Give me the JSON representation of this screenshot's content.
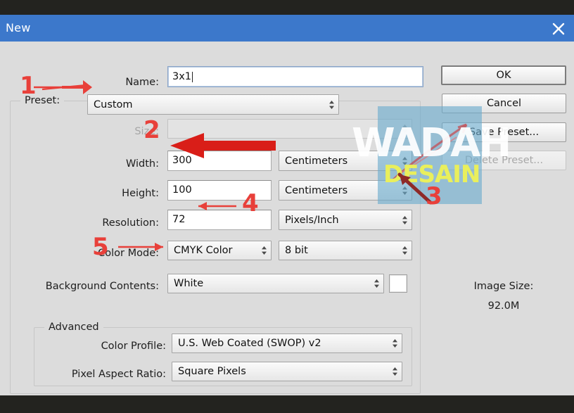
{
  "window": {
    "title": "New",
    "close_icon": "close-icon"
  },
  "form": {
    "name": {
      "label": "Name:",
      "value": "3x1"
    },
    "preset": {
      "label": "Preset:",
      "value": "Custom"
    },
    "size": {
      "label": "Size:",
      "value": ""
    },
    "width": {
      "label": "Width:",
      "value": "300",
      "unit": "Centimeters"
    },
    "height": {
      "label": "Height:",
      "value": "100",
      "unit": "Centimeters"
    },
    "resolution": {
      "label": "Resolution:",
      "value": "72",
      "unit": "Pixels/Inch"
    },
    "color_mode": {
      "label": "Color Mode:",
      "value": "CMYK Color",
      "depth": "8 bit"
    },
    "background": {
      "label": "Background Contents:",
      "value": "White",
      "swatch_color": "#ffffff"
    }
  },
  "advanced": {
    "legend": "Advanced",
    "color_profile": {
      "label": "Color Profile:",
      "value": "U.S. Web Coated (SWOP) v2"
    },
    "pixel_aspect_ratio": {
      "label": "Pixel Aspect Ratio:",
      "value": "Square Pixels"
    }
  },
  "buttons": {
    "ok": "OK",
    "cancel": "Cancel",
    "save_preset": "Save Preset...",
    "delete_preset": "Delete Preset..."
  },
  "image_size": {
    "label": "Image Size:",
    "value": "92.0M"
  },
  "annotations": [
    {
      "number": "1",
      "target": "preset-combo"
    },
    {
      "number": "2",
      "target": "width-input"
    },
    {
      "number": "3",
      "target": "height-unit-combo"
    },
    {
      "number": "4",
      "target": "resolution-input"
    },
    {
      "number": "5",
      "target": "color-mode-combo"
    }
  ],
  "watermark": {
    "line1": "WADAH",
    "line2": "DESAIN",
    "box_color": "#6aabcd",
    "line1_color": "#ffffff",
    "line2_color": "#e9ef5c"
  },
  "colors": {
    "titlebar": "#3c78cb",
    "dialog_bg": "#dcdcdc",
    "chrome_bar": "#23231f",
    "annotation_red": "#e8403a",
    "annotation_dark_red": "#9e2b28"
  }
}
